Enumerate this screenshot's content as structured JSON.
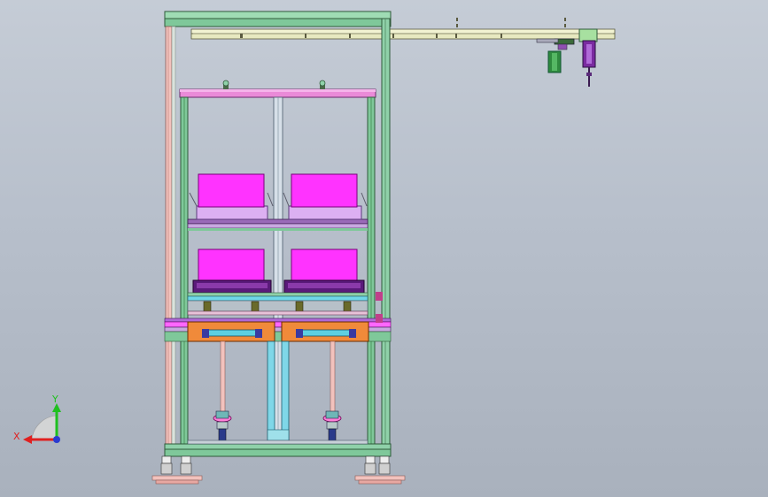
{
  "viewport": {
    "background_top": "#c5ccd6",
    "background_bottom": "#a9b1bd"
  },
  "colors": {
    "frame_green": "#8fd1a9",
    "frame_dark_green": "#3f8a4f",
    "rail_cream": "#eef0c8",
    "pink_post": "#efb3ad",
    "magenta": "#ff33ff",
    "lavender": "#d9a6f0",
    "purple": "#6a2a8a",
    "cyan": "#5ecfe0",
    "orange": "#f08a3a",
    "teal_rod": "#6fb7b7"
  },
  "triad": {
    "x_label": "X",
    "y_label": "Y",
    "x_color": "#e02020",
    "y_color": "#20c020",
    "origin_color": "#2a3bd0"
  }
}
